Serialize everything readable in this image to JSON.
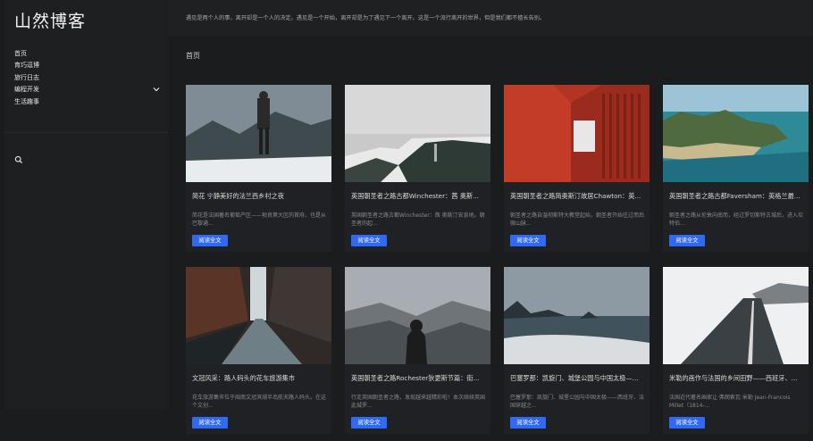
{
  "site": {
    "logo": "山然博客"
  },
  "nav": {
    "items": [
      {
        "label": "首页"
      },
      {
        "label": "育巧逗博"
      },
      {
        "label": "旅行日志"
      },
      {
        "label": "编程开发"
      },
      {
        "label": "生活趣事"
      }
    ]
  },
  "topbar": {
    "announcement": "遇见是两个人的事，离开却是一个人的决定。遇见是一个开始，离开却是为了遇见下一个离开。这是一个流行离开的世界，但是我们都不擅长告别。"
  },
  "main": {
    "heading": "首页"
  },
  "read_more_label": "阅读全文",
  "posts": [
    {
      "title": "简花 宁静美好的法兰西乡村之夜",
      "excerpt": "简花是法国著名葡萄产区——勃良第大区的首府。也是从巴黎通..."
    },
    {
      "title": "英国朝圣者之路古都Winchester：茜 奥斯...",
      "excerpt": "英国朝圣者之路古都Winchester：茜 奥斯汀安息地。朝圣者的起..."
    },
    {
      "title": "英国朝圣者之路简奥斯汀故居Chawton：英...",
      "excerpt": "朝圣者之路自温彻斯特大教堂起始，朝圣者开始往过而后微山脉..."
    },
    {
      "title": "英国朝圣者之路古都Faversham：英格兰最...",
      "excerpt": "朝圣者之路从伦敦向南而，经过罗切斯特古城后，进入坎特伯..."
    },
    {
      "title": "文冠风采：路人码头的花车旅游集市",
      "excerpt": "花车旅游集市位于闽南文冠滨湖半岛航天路人码头。在这个文创..."
    },
    {
      "title": "英国朝圣者之路Rochester狄更斯节篇：街...",
      "excerpt": "行走英国朝圣者之路，发现越来越精彩啦！本次续续英国此城罗..."
    },
    {
      "title": "巴塞罗那：凯旋门、城堡公园与中国太极——...",
      "excerpt": "巴塞罗那：凯旋门、城堡公园与中国太极——西班牙、法国穿越之..."
    },
    {
      "title": "米勒的画作与法国的乡间田野——西班牙、...",
      "excerpt": "法国近代著名画家让·弗朗索瓦·米勒 Jean-Francois Millet（1814-..."
    }
  ],
  "colors": {
    "page_bg": "#1b1c1e",
    "sidebar_bg": "#1e1f21",
    "card_bg": "#202124",
    "accent_button": "#2f69f5"
  }
}
